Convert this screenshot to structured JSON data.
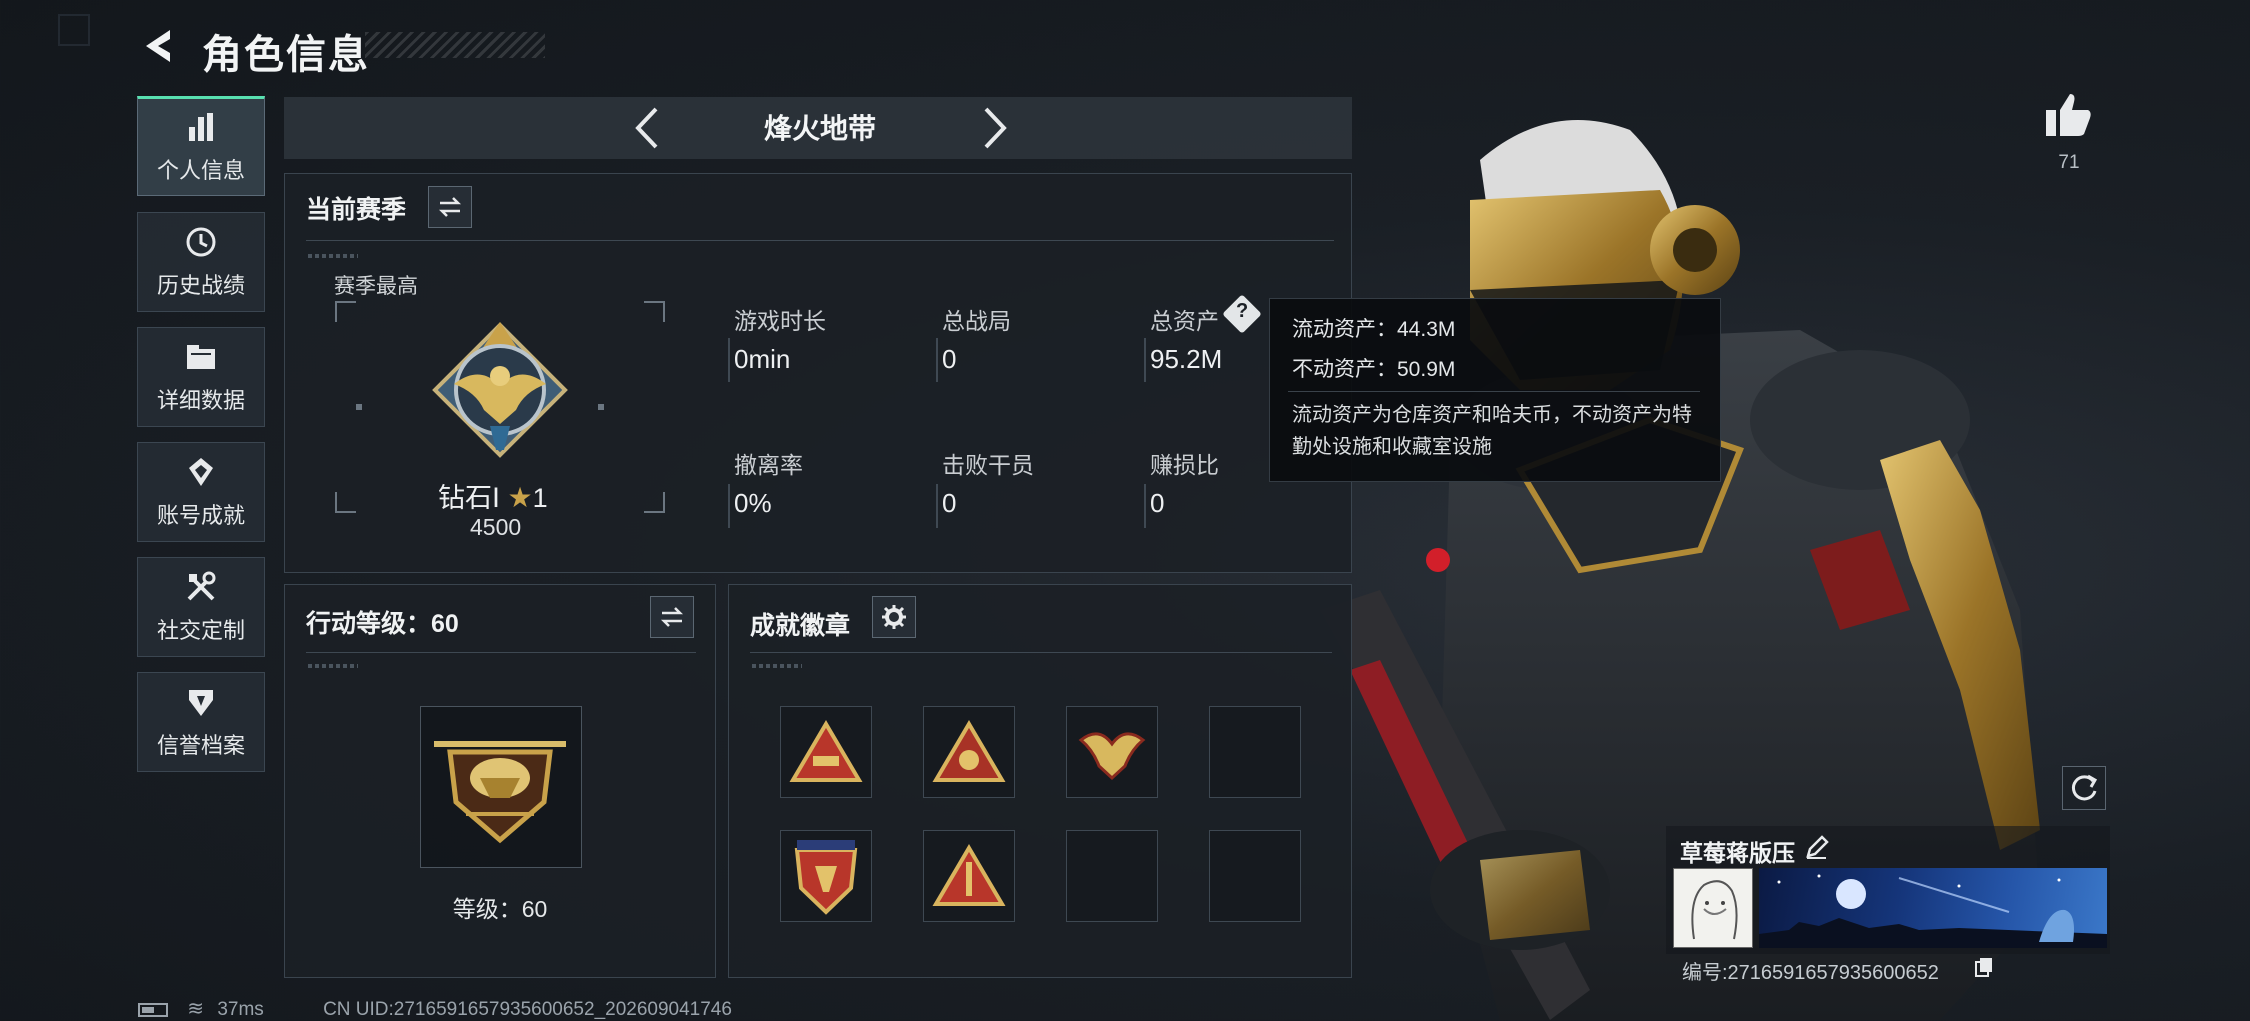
{
  "header": {
    "title": "角色信息"
  },
  "sidebar": {
    "items": [
      {
        "label": "个人信息",
        "icon": "bar-chart-icon",
        "active": true
      },
      {
        "label": "历史战绩",
        "icon": "history-icon",
        "active": false
      },
      {
        "label": "详细数据",
        "icon": "folder-icon",
        "active": false
      },
      {
        "label": "账号成就",
        "icon": "achievement-icon",
        "active": false
      },
      {
        "label": "社交定制",
        "icon": "tools-icon",
        "active": false
      },
      {
        "label": "信誉档案",
        "icon": "shield-icon",
        "active": false
      }
    ]
  },
  "mode_tabs": {
    "current": "烽火地带"
  },
  "season": {
    "title": "当前赛季",
    "best_label": "赛季最高",
    "rank_name": "钻石Ⅰ",
    "rank_stars": "1",
    "rank_points": "4500",
    "stats": [
      {
        "label": "游戏时长",
        "value": "0min"
      },
      {
        "label": "总战局",
        "value": "0"
      },
      {
        "label": "总资产",
        "value": "95.2M"
      },
      {
        "label": "撤离率",
        "value": "0%"
      },
      {
        "label": "击败干员",
        "value": "0"
      },
      {
        "label": "赚损比",
        "value": "0"
      }
    ]
  },
  "tooltip": {
    "liquid": "流动资产：44.3M",
    "fixed": "不动资产：50.9M",
    "desc": "流动资产为仓库资产和哈夫币，不动资产为特勤处设施和收藏室设施"
  },
  "action_level": {
    "title": "行动等级：60",
    "level_text": "等级：60"
  },
  "achievements": {
    "title": "成就徽章",
    "badges_filled": 5,
    "slots": 8
  },
  "likes": {
    "count": "71"
  },
  "player": {
    "name": "草莓蒋版压",
    "id": "编号:2716591657935600652"
  },
  "status": {
    "ping": "37ms",
    "uid": "CN UID:2716591657935600652_202609041746"
  },
  "colors": {
    "accent": "#58e0b0",
    "gold": "#c9a24a",
    "panel_bg": "#1b2026"
  }
}
